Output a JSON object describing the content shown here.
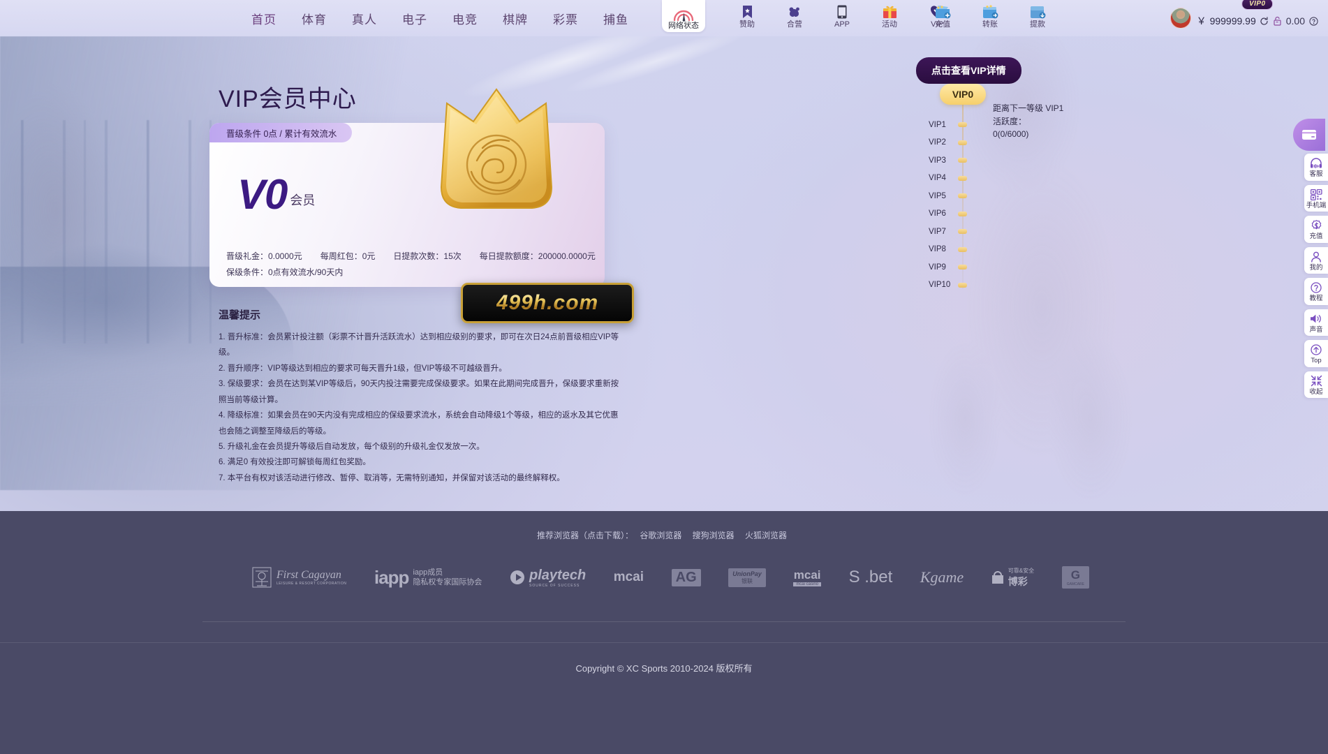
{
  "header": {
    "nav": [
      {
        "label": "首页",
        "name": "nav-home"
      },
      {
        "label": "体育",
        "name": "nav-sports"
      },
      {
        "label": "真人",
        "name": "nav-live"
      },
      {
        "label": "电子",
        "name": "nav-slots"
      },
      {
        "label": "电竞",
        "name": "nav-esports"
      },
      {
        "label": "棋牌",
        "name": "nav-chess"
      },
      {
        "label": "彩票",
        "name": "nav-lottery"
      },
      {
        "label": "捕鱼",
        "name": "nav-fishing"
      }
    ],
    "net_status": {
      "label": "网络状态",
      "icon": "wifi-signal-icon"
    },
    "icons_left": [
      {
        "label": "赞助",
        "icon": "bookmark-star-icon"
      },
      {
        "label": "合营",
        "icon": "handshake-icon"
      },
      {
        "label": "APP",
        "icon": "mobile-phone-icon"
      },
      {
        "label": "活动",
        "icon": "gift-icon"
      },
      {
        "label": "VIP",
        "icon": "vip-shield-icon"
      }
    ],
    "icons_right": [
      {
        "label": "充值",
        "icon": "deposit-wallet-icon"
      },
      {
        "label": "转账",
        "icon": "transfer-wallet-icon"
      },
      {
        "label": "提款",
        "icon": "withdraw-wallet-icon"
      }
    ],
    "account": {
      "vip_badge": "VIP0",
      "currency_symbol": "￥",
      "main_balance": "999999.99",
      "locked_balance": "0.00",
      "refresh_icon": "refresh-icon",
      "lock_icon": "lock-icon",
      "help_icon": "question-mark-icon",
      "avatar_icon": "user-avatar"
    }
  },
  "main": {
    "page_title": "VIP会员中心",
    "card": {
      "condition_badge": "晋级条件 0点 / 累计有效流水",
      "level": "V0",
      "level_suffix": "会员",
      "crown_icon": "gold-crown-icon",
      "stats_row1": [
        "晋级礼金：0.0000元",
        "每周红包：0元",
        "日提款次数：15次",
        "每日提款额度：200000.0000元"
      ],
      "stats_row2": "保级条件：0点有效流水/90天内"
    },
    "watermark": "499h.com",
    "tips_title": "温馨提示",
    "tips": [
      "1. 晋升标准：会员累计投注额（彩票不计晋升活跃流水）达到相应级别的要求，即可在次日24点前晋级相应VIP等级。",
      "2. 晋升顺序：VIP等级达到相应的要求可每天晋升1级，但VIP等级不可越级晋升。",
      "3. 保级要求：会员在达到某VIP等级后，90天内投注需要完成保级要求。如果在此期间完成晋升，保级要求重新按照当前等级计算。",
      "4. 降级标准：如果会员在90天内没有完成相应的保级要求流水，系统会自动降级1个等级，相应的返水及其它优惠也会随之调整至降级后的等级。",
      "5. 升级礼金在会员提升等级后自动发放，每个级别的升级礼金仅发放一次。",
      "6. 满足0 有效投注即可解锁每周红包奖励。",
      "7. 本平台有权对该活动进行修改、暂停、取消等，无需特别通知，并保留对该活动的最终解释权。"
    ]
  },
  "vip_ladder": {
    "detail_button": "点击查看VIP详情",
    "current_level": "VIP0",
    "next_info": "距离下一等级 VIP1\n活跃度：\n0(0/6000)",
    "levels": [
      "VIP1",
      "VIP2",
      "VIP3",
      "VIP4",
      "VIP5",
      "VIP6",
      "VIP7",
      "VIP8",
      "VIP9",
      "VIP10"
    ]
  },
  "float_toolbar": {
    "top_icon": "card-collapse-icon",
    "items": [
      {
        "label": "客服",
        "icon": "headset-icon"
      },
      {
        "label": "手机端",
        "icon": "qr-code-icon"
      },
      {
        "label": "充值",
        "icon": "coin-gear-icon"
      },
      {
        "label": "我的",
        "icon": "person-icon"
      },
      {
        "label": "教程",
        "icon": "question-circle-icon"
      },
      {
        "label": "声音",
        "icon": "speaker-icon"
      },
      {
        "label": "Top",
        "icon": "arrow-up-circle-icon"
      },
      {
        "label": "收起",
        "icon": "collapse-arrows-icon"
      }
    ]
  },
  "footer": {
    "browsers_label": "推荐浏览器（点击下载）：",
    "browsers": [
      "谷歌浏览器",
      "搜狗浏览器",
      "火狐浏览器"
    ],
    "logos": [
      {
        "name": "first-cagayan-logo",
        "main": "First Cagayan",
        "sub": "LEISURE & RESORT CORPORATION"
      },
      {
        "name": "iapp-logo",
        "main": "iapp",
        "sub1": "iapp成员",
        "sub2": "隐私权专家国际协会"
      },
      {
        "name": "playtech-logo",
        "main": "playtech",
        "sub": "SOURCE OF SUCCESS"
      },
      {
        "name": "micai-logo",
        "main": "mcai",
        "sub": ""
      },
      {
        "name": "ag-logo",
        "main": "AG",
        "sub": ""
      },
      {
        "name": "unionpay-logo",
        "main": "UnionPay",
        "sub": "银联"
      },
      {
        "name": "micai-casino-logo",
        "main": "mcai",
        "sub": "mcai casino"
      },
      {
        "name": "sobet-logo",
        "main": "S .bet",
        "sub": ""
      },
      {
        "name": "kgame-logo",
        "main": "Kgame",
        "sub": ""
      },
      {
        "name": "bocai-logo",
        "main": "博彩",
        "sub": "可靠&安全"
      },
      {
        "name": "gamcare-logo",
        "main": "G",
        "sub": "GAMCARE"
      }
    ],
    "copyright": "Copyright © XC Sports 2010-2024 版权所有"
  }
}
